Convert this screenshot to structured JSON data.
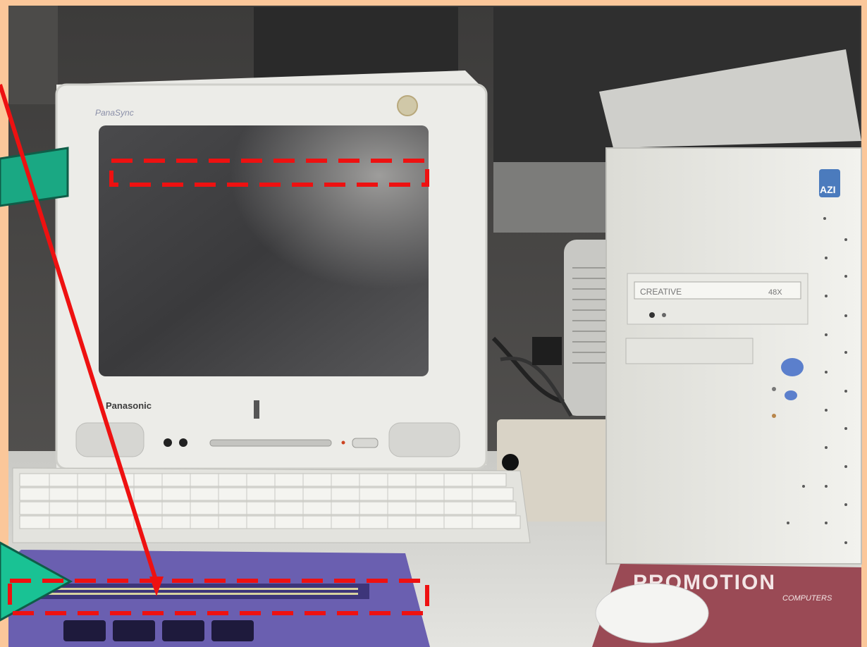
{
  "photo": {
    "monitor_brand_label": "Panasonic",
    "monitor_model_label": "PanaSync",
    "tower_badge": "AZI",
    "drive_brand": "CREATIVE",
    "drive_model": "48X",
    "mousepad_title": "PROMOTION",
    "mousepad_subtitle": "COMPUTERS"
  },
  "annotations": {
    "frame_color": "#fbc79a",
    "arrow_color": "#ee1111",
    "highlight_color": "#ee1111",
    "callout_color": "#1aa883",
    "highlight_screen_line": "dashed red box over top line of monitor screen",
    "highlight_braille_line": "dashed red box over braille display cells"
  }
}
